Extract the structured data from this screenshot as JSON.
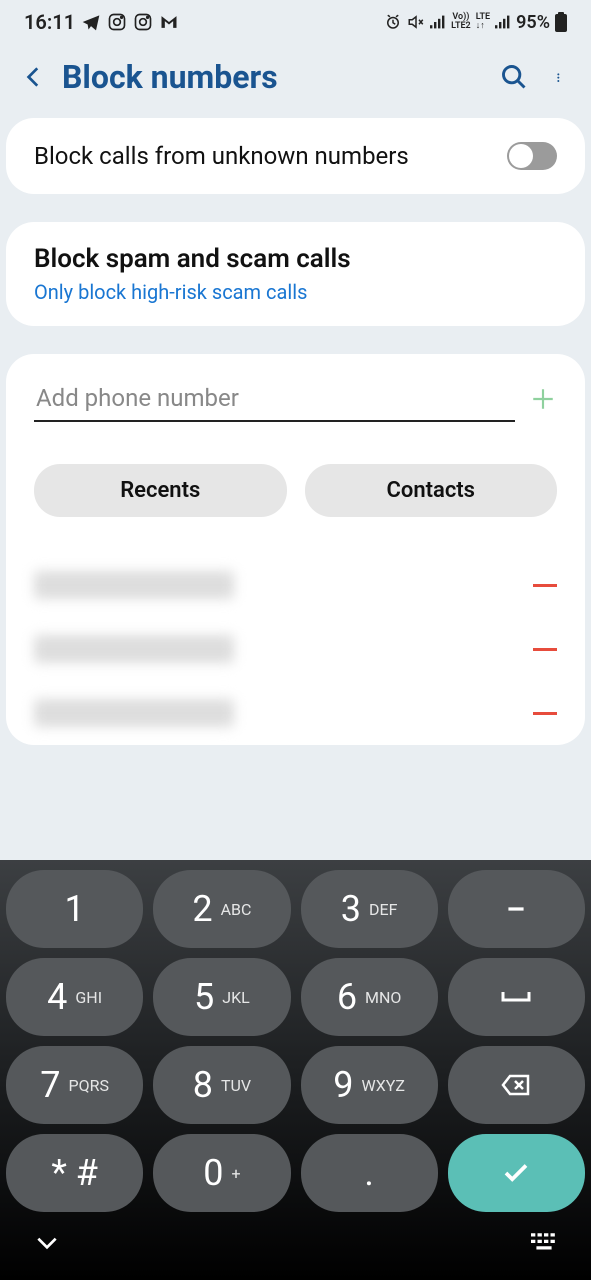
{
  "status": {
    "time": "16:11",
    "battery": "95%"
  },
  "header": {
    "title": "Block numbers"
  },
  "block_unknown": {
    "label": "Block calls from unknown numbers",
    "enabled": false
  },
  "block_spam": {
    "title": "Block spam and scam calls",
    "subtitle": "Only block high-risk scam calls"
  },
  "input": {
    "placeholder": "Add phone number"
  },
  "buttons": {
    "recents": "Recents",
    "contacts": "Contacts"
  },
  "blocked": [
    "",
    "",
    ""
  ],
  "keypad": {
    "rows": [
      [
        {
          "d": "1",
          "l": ""
        },
        {
          "d": "2",
          "l": "ABC"
        },
        {
          "d": "3",
          "l": "DEF"
        },
        {
          "sym": "minus"
        }
      ],
      [
        {
          "d": "4",
          "l": "GHI"
        },
        {
          "d": "5",
          "l": "JKL"
        },
        {
          "d": "6",
          "l": "MNO"
        },
        {
          "sym": "space"
        }
      ],
      [
        {
          "d": "7",
          "l": "PQRS"
        },
        {
          "d": "8",
          "l": "TUV"
        },
        {
          "d": "9",
          "l": "WXYZ"
        },
        {
          "sym": "backspace"
        }
      ],
      [
        {
          "d": "* #",
          "l": ""
        },
        {
          "d": "0",
          "l": "+"
        },
        {
          "d": ".",
          "l": ""
        },
        {
          "sym": "confirm"
        }
      ]
    ]
  }
}
